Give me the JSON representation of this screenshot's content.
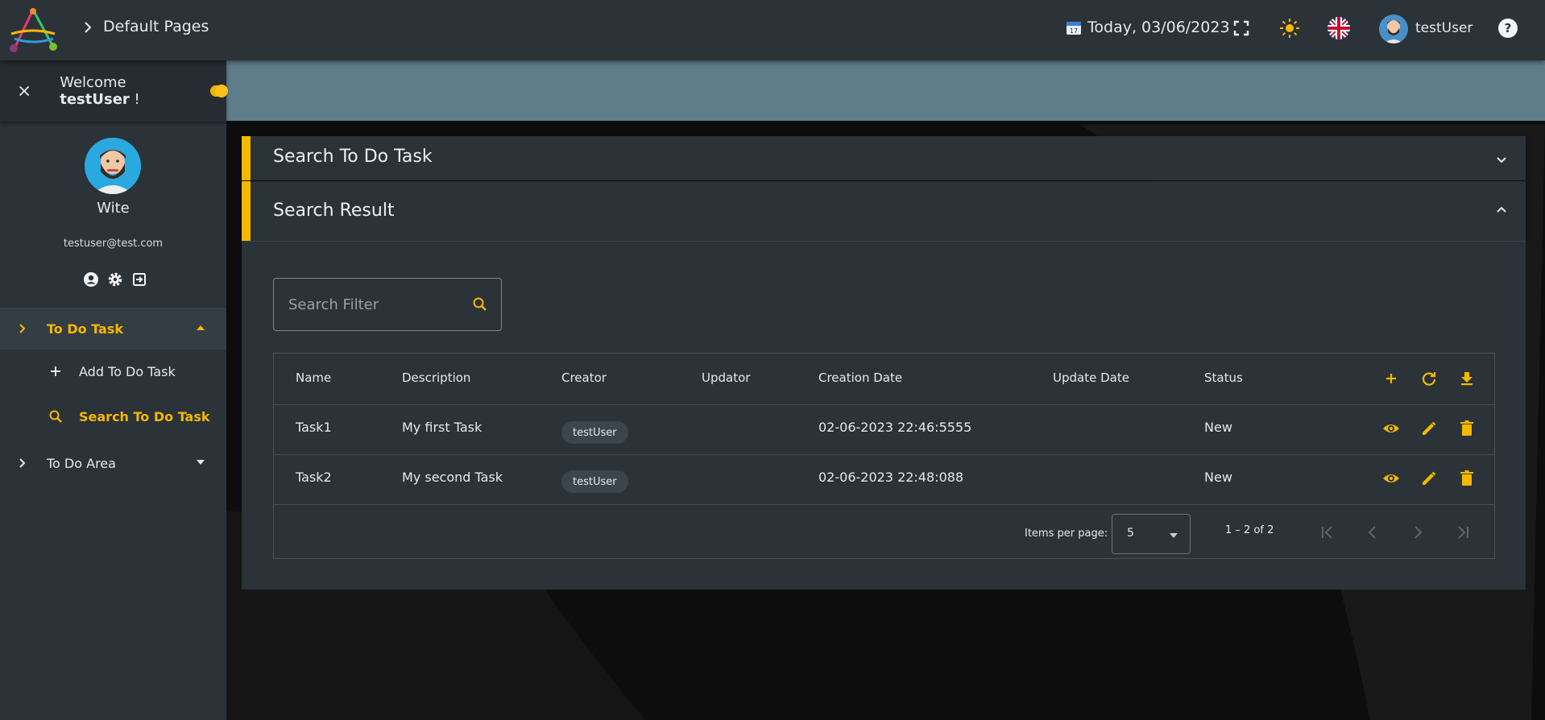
{
  "topbar": {
    "breadcrumb": "Default Pages",
    "date": "Today, 03/06/2023",
    "user": "testUser"
  },
  "sidebar": {
    "welcome_prefix": "Welcome",
    "welcome_user": "testUser",
    "welcome_suffix": "!",
    "profile_name": "Wite",
    "profile_email": "testuser@test.com",
    "nav": [
      {
        "label": "To Do Task"
      },
      {
        "label": "To Do Area"
      }
    ],
    "sub": [
      {
        "label": "Add To Do Task"
      },
      {
        "label": "Search To Do Task"
      }
    ]
  },
  "panels": {
    "search_title": "Search To Do Task",
    "result_title": "Search Result"
  },
  "search": {
    "placeholder": "Search Filter"
  },
  "table": {
    "headers": [
      "Name",
      "Description",
      "Creator",
      "Updator",
      "Creation Date",
      "Update Date",
      "Status"
    ],
    "rows": [
      {
        "name": "Task1",
        "description": "My first Task",
        "creator": "testUser",
        "updator": "",
        "creation_date": "02-06-2023 22:46:5555",
        "update_date": "",
        "status": "New"
      },
      {
        "name": "Task2",
        "description": "My second Task",
        "creator": "testUser",
        "updator": "",
        "creation_date": "02-06-2023 22:48:088",
        "update_date": "",
        "status": "New"
      }
    ]
  },
  "paginator": {
    "items_per_page_label": "Items per page:",
    "page_size": "5",
    "range": "1 – 2 of 2"
  },
  "colors": {
    "accent": "#f5b800",
    "panel": "#2b3238",
    "banner": "#5f7c8b"
  }
}
